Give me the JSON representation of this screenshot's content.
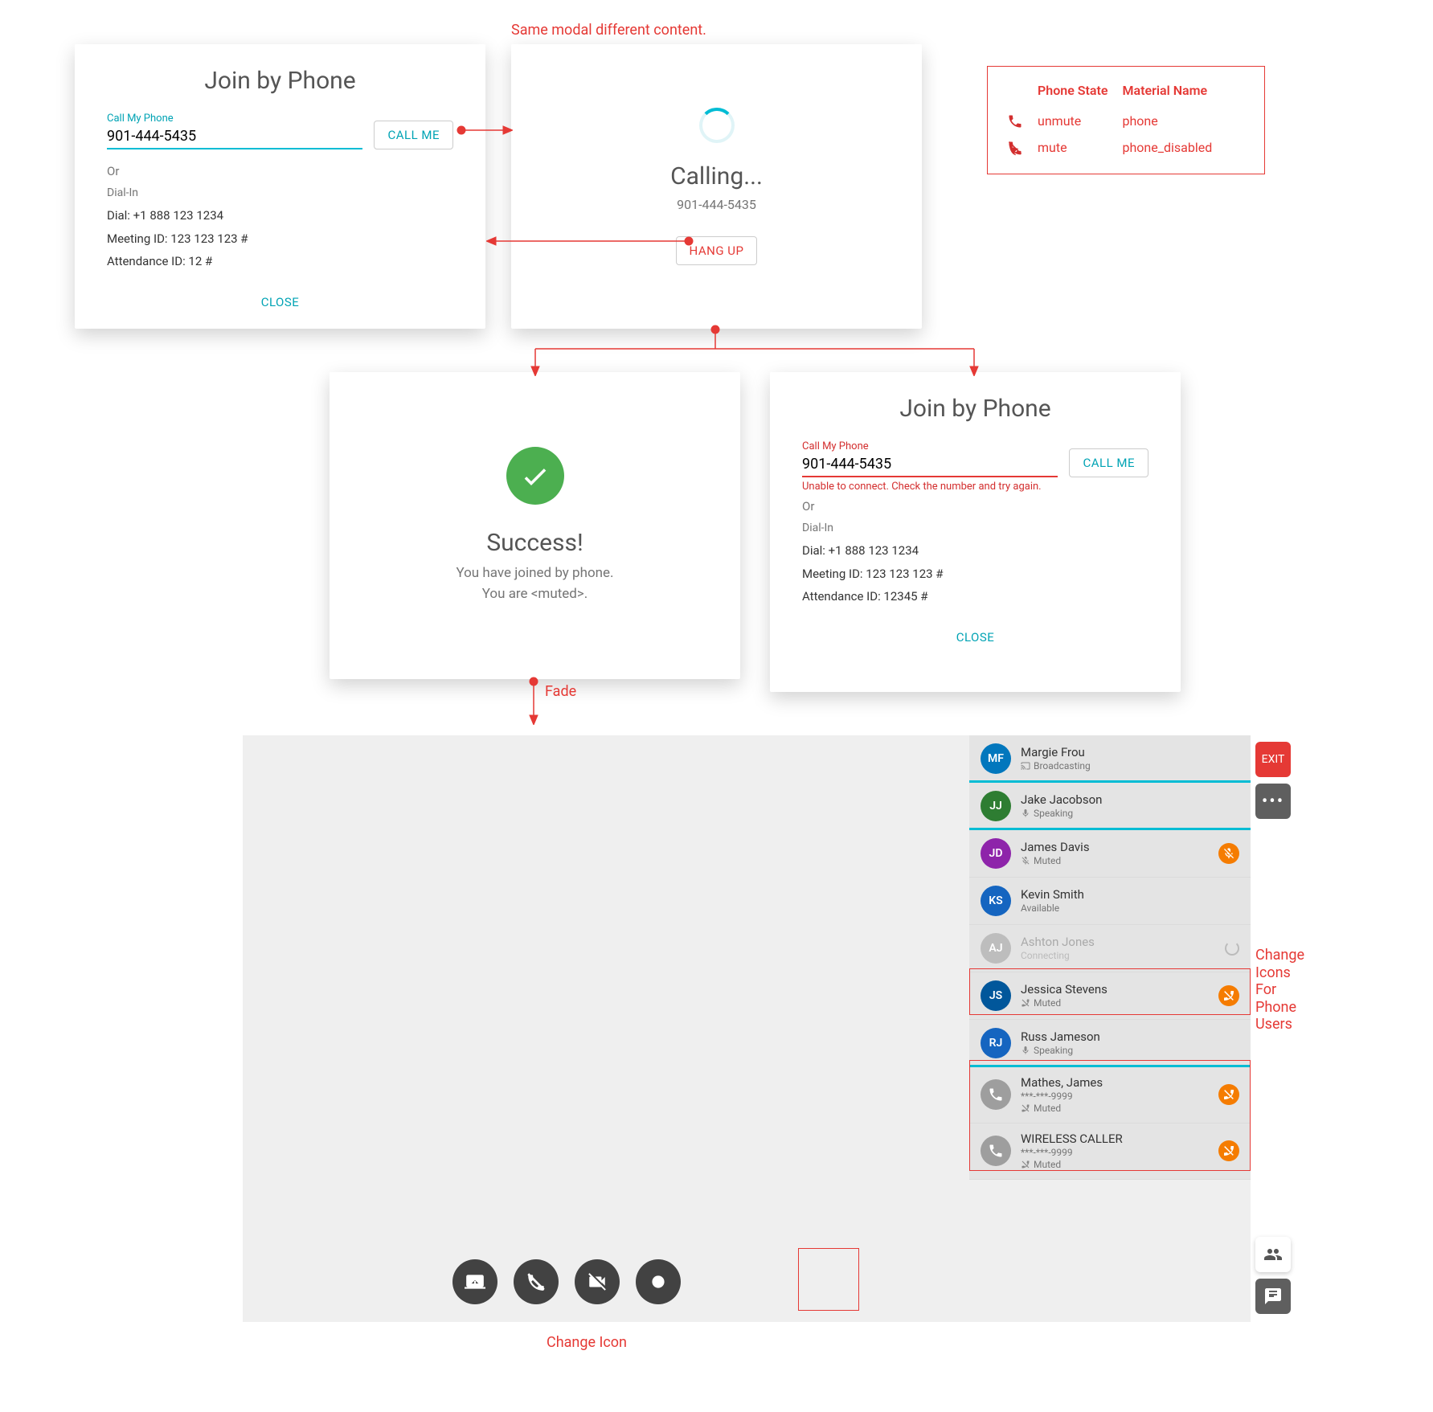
{
  "notes": {
    "same_modal": "Same modal different content.",
    "fade": "Fade",
    "change_icon": "Change Icon",
    "change_icons_phone": "Change\nIcons\nFor\nPhone\nUsers"
  },
  "legend": {
    "col_state": "Phone State",
    "col_material": "Material Name",
    "rows": [
      {
        "state": "unmute",
        "material": "phone",
        "icon": "phone"
      },
      {
        "state": "mute",
        "material": "phone_disabled",
        "icon": "phone-disabled"
      }
    ]
  },
  "modal_join": {
    "title": "Join by Phone",
    "field_label": "Call My Phone",
    "phone_value": "901-444-5435",
    "call_me": "CALL ME",
    "or": "Or",
    "dialin_title": "Dial-In",
    "dial": "Dial: +1 888 123 1234",
    "meeting_id": "Meeting ID: 123 123 123 #",
    "attendance_id": "Attendance ID: 12 #",
    "close": "CLOSE"
  },
  "modal_calling": {
    "title": "Calling...",
    "number": "901-444-5435",
    "hang_up": "HANG UP"
  },
  "modal_success": {
    "title": "Success!",
    "line1": "You have joined by phone.",
    "line2": "You are <muted>."
  },
  "modal_error": {
    "title": "Join by Phone",
    "field_label": "Call My Phone",
    "phone_value": "901-444-5435",
    "call_me": "CALL ME",
    "error_msg": "Unable to connect. Check the number and try again.",
    "or": "Or",
    "dialin_title": "Dial-In",
    "dial": "Dial: +1 888 123 1234",
    "meeting_id": "Meeting ID: 123 123 123 #",
    "attendance_id": "Attendance ID: 12345 #",
    "close": "CLOSE"
  },
  "meeting": {
    "exit": "EXIT",
    "participants": [
      {
        "initials": "MF",
        "name": "Margie Frou",
        "status": "Broadcasting",
        "status_icon": "cast",
        "color": "#0277bd",
        "active": true,
        "badge": null
      },
      {
        "initials": "JJ",
        "name": "Jake Jacobson",
        "status": "Speaking",
        "status_icon": "mic",
        "color": "#2e7d32",
        "active": true,
        "badge": null
      },
      {
        "initials": "JD",
        "name": "James Davis",
        "status": "Muted",
        "status_icon": "mic-off",
        "color": "#8e24aa",
        "active": false,
        "badge": "mic-off"
      },
      {
        "initials": "KS",
        "name": "Kevin Smith",
        "status": "Available",
        "status_icon": null,
        "color": "#1565c0",
        "active": false,
        "badge": null
      },
      {
        "initials": "AJ",
        "name": "Ashton Jones",
        "status": "Connecting",
        "status_icon": null,
        "color": "#bdbdbd",
        "active": false,
        "badge": "spinner",
        "dim": true
      },
      {
        "initials": "JS",
        "name": "Jessica Stevens",
        "status": "Muted",
        "status_icon": "phone-disabled",
        "color": "#01579b",
        "active": false,
        "badge": "phone-disabled"
      },
      {
        "initials": "RJ",
        "name": "Russ Jameson",
        "status": "Speaking",
        "status_icon": "mic",
        "color": "#1565c0",
        "active": true,
        "badge": null
      },
      {
        "phone": true,
        "name": "Mathes, James",
        "sub": "***-***-9999",
        "status": "Muted",
        "status_icon": "phone-disabled",
        "badge": "phone-disabled"
      },
      {
        "phone": true,
        "name": "WIRELESS CALLER",
        "sub": "***-***-9999",
        "status": "Muted",
        "status_icon": "phone-disabled",
        "badge": "phone-disabled"
      }
    ]
  }
}
